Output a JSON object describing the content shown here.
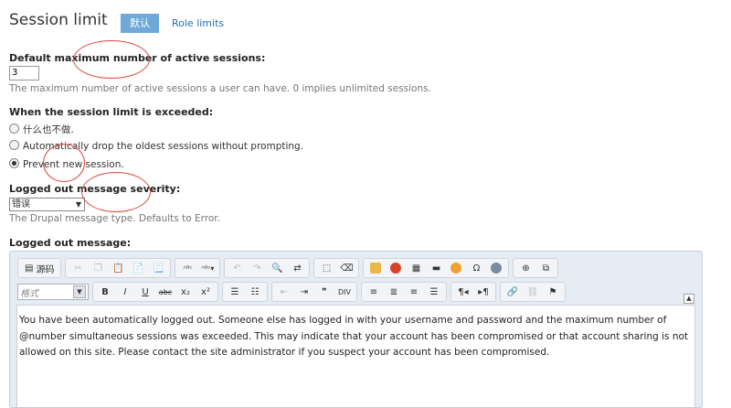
{
  "header": {
    "title": "Session limit",
    "tabs": [
      {
        "label": "默认",
        "active": true
      },
      {
        "label": "Role limits",
        "active": false
      }
    ]
  },
  "max_sessions": {
    "label": "Default maximum number of active sessions:",
    "value": "3",
    "description": "The maximum number of active sessions a user can have. 0 implies unlimited sessions."
  },
  "exceeded": {
    "label": "When the session limit is exceeded:",
    "options": [
      {
        "label": "什么也不做.",
        "checked": false
      },
      {
        "label": "Automatically drop the oldest sessions without prompting.",
        "checked": false
      },
      {
        "label": "Prevent new session.",
        "checked": true
      }
    ]
  },
  "severity": {
    "label": "Logged out message severity:",
    "selected": "错误",
    "description": "The Drupal message type. Defaults to Error."
  },
  "message": {
    "label": "Logged out message:",
    "source_label": "源码",
    "format_placeholder": "格式",
    "content": "You have been automatically logged out. Someone else has logged in with your username and password and the maximum number of @number simultaneous sessions was exceeded. This may indicate that your account has been compromised or that account sharing is not allowed on this site. Please contact the site administrator if you suspect your account has been compromised."
  },
  "colors": {
    "tab_active_bg": "#6ea9d9",
    "link": "#1f6fb8",
    "annotation": "#d94a3a"
  }
}
